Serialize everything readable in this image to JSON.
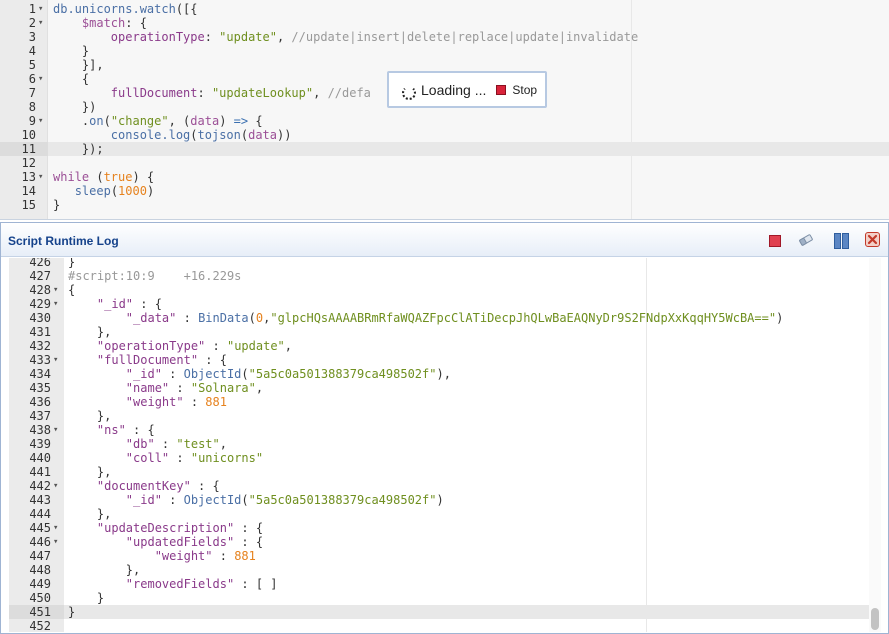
{
  "editor": {
    "lines": [
      {
        "n": "1",
        "fold": "▾",
        "segs": [
          [
            "fn",
            "db.unicorns.watch"
          ],
          [
            "op",
            "([{"
          ]
        ]
      },
      {
        "n": "2",
        "fold": "▾",
        "segs": [
          [
            "op",
            "    "
          ],
          [
            "kw",
            "$match"
          ],
          [
            "op",
            ": {"
          ]
        ]
      },
      {
        "n": "3",
        "fold": "",
        "segs": [
          [
            "op",
            "        "
          ],
          [
            "pr",
            "operationType"
          ],
          [
            "op",
            ": "
          ],
          [
            "st",
            "\"update\""
          ],
          [
            "op",
            ", "
          ],
          [
            "cm",
            "//update|insert|delete|replace|update|invalidate"
          ]
        ]
      },
      {
        "n": "4",
        "fold": "",
        "segs": [
          [
            "op",
            "    }"
          ]
        ]
      },
      {
        "n": "5",
        "fold": "",
        "segs": [
          [
            "op",
            "    }],"
          ]
        ]
      },
      {
        "n": "6",
        "fold": "▾",
        "segs": [
          [
            "op",
            "    {"
          ]
        ]
      },
      {
        "n": "7",
        "fold": "",
        "segs": [
          [
            "op",
            "        "
          ],
          [
            "pr",
            "fullDocument"
          ],
          [
            "op",
            ": "
          ],
          [
            "st",
            "\"updateLookup\""
          ],
          [
            "op",
            ", "
          ],
          [
            "cm",
            "//defa"
          ]
        ]
      },
      {
        "n": "8",
        "fold": "",
        "segs": [
          [
            "op",
            "    })"
          ]
        ]
      },
      {
        "n": "9",
        "fold": "▾",
        "segs": [
          [
            "op",
            "    ."
          ],
          [
            "fn",
            "on"
          ],
          [
            "op",
            "("
          ],
          [
            "st",
            "\"change\""
          ],
          [
            "op",
            ", ("
          ],
          [
            "kw",
            "data"
          ],
          [
            "op",
            ") "
          ],
          [
            "bl",
            "=>"
          ],
          [
            "op",
            " {"
          ]
        ]
      },
      {
        "n": "10",
        "fold": "",
        "segs": [
          [
            "op",
            "        "
          ],
          [
            "fn",
            "console.log"
          ],
          [
            "op",
            "("
          ],
          [
            "fn",
            "tojson"
          ],
          [
            "op",
            "("
          ],
          [
            "kw",
            "data"
          ],
          [
            "op",
            "))"
          ]
        ]
      },
      {
        "n": "11",
        "fold": "",
        "segs": [
          [
            "op",
            "    });"
          ]
        ],
        "active": true
      },
      {
        "n": "12",
        "fold": "",
        "segs": []
      },
      {
        "n": "13",
        "fold": "▾",
        "segs": [
          [
            "kw",
            "while"
          ],
          [
            "op",
            " ("
          ],
          [
            "nu",
            "true"
          ],
          [
            "op",
            ") {"
          ]
        ]
      },
      {
        "n": "14",
        "fold": "",
        "segs": [
          [
            "op",
            "   "
          ],
          [
            "fn",
            "sleep"
          ],
          [
            "op",
            "("
          ],
          [
            "nu",
            "1000"
          ],
          [
            "op",
            ")"
          ]
        ]
      },
      {
        "n": "15",
        "fold": "",
        "segs": [
          [
            "op",
            "}"
          ]
        ]
      }
    ]
  },
  "loading": {
    "text": "Loading ...",
    "stop_label": "Stop"
  },
  "log_panel": {
    "title": "Script Runtime Log",
    "lines": [
      {
        "n": "426",
        "fold": "",
        "segs": [
          [
            "op",
            "}"
          ]
        ]
      },
      {
        "n": "427",
        "fold": "",
        "segs": [
          [
            "cm",
            "#script:10:9    +16.229s"
          ]
        ]
      },
      {
        "n": "428",
        "fold": "▾",
        "segs": [
          [
            "op",
            "{"
          ]
        ]
      },
      {
        "n": "429",
        "fold": "▾",
        "segs": [
          [
            "op",
            "    "
          ],
          [
            "pr",
            "\"_id\""
          ],
          [
            "op",
            " : {"
          ]
        ]
      },
      {
        "n": "430",
        "fold": "",
        "segs": [
          [
            "op",
            "        "
          ],
          [
            "pr",
            "\"_data\""
          ],
          [
            "op",
            " : "
          ],
          [
            "fn",
            "BinData"
          ],
          [
            "op",
            "("
          ],
          [
            "nu",
            "0"
          ],
          [
            "op",
            ","
          ],
          [
            "st",
            "\"glpcHQsAAAABRmRfaWQAZFpcClATiDecpJhQLwBaEAQNyDr9S2FNdpXxKqqHY5WcBA==\""
          ],
          [
            "op",
            ")"
          ]
        ]
      },
      {
        "n": "431",
        "fold": "",
        "segs": [
          [
            "op",
            "    },"
          ]
        ]
      },
      {
        "n": "432",
        "fold": "",
        "segs": [
          [
            "op",
            "    "
          ],
          [
            "pr",
            "\"operationType\""
          ],
          [
            "op",
            " : "
          ],
          [
            "st",
            "\"update\""
          ],
          [
            "op",
            ","
          ]
        ]
      },
      {
        "n": "433",
        "fold": "▾",
        "segs": [
          [
            "op",
            "    "
          ],
          [
            "pr",
            "\"fullDocument\""
          ],
          [
            "op",
            " : {"
          ]
        ]
      },
      {
        "n": "434",
        "fold": "",
        "segs": [
          [
            "op",
            "        "
          ],
          [
            "pr",
            "\"_id\""
          ],
          [
            "op",
            " : "
          ],
          [
            "fn",
            "ObjectId"
          ],
          [
            "op",
            "("
          ],
          [
            "st",
            "\"5a5c0a501388379ca498502f\""
          ],
          [
            "op",
            "),"
          ]
        ]
      },
      {
        "n": "435",
        "fold": "",
        "segs": [
          [
            "op",
            "        "
          ],
          [
            "pr",
            "\"name\""
          ],
          [
            "op",
            " : "
          ],
          [
            "st",
            "\"Solnara\""
          ],
          [
            "op",
            ","
          ]
        ]
      },
      {
        "n": "436",
        "fold": "",
        "segs": [
          [
            "op",
            "        "
          ],
          [
            "pr",
            "\"weight\""
          ],
          [
            "op",
            " : "
          ],
          [
            "nu",
            "881"
          ]
        ]
      },
      {
        "n": "437",
        "fold": "",
        "segs": [
          [
            "op",
            "    },"
          ]
        ]
      },
      {
        "n": "438",
        "fold": "▾",
        "segs": [
          [
            "op",
            "    "
          ],
          [
            "pr",
            "\"ns\""
          ],
          [
            "op",
            " : {"
          ]
        ]
      },
      {
        "n": "439",
        "fold": "",
        "segs": [
          [
            "op",
            "        "
          ],
          [
            "pr",
            "\"db\""
          ],
          [
            "op",
            " : "
          ],
          [
            "st",
            "\"test\""
          ],
          [
            "op",
            ","
          ]
        ]
      },
      {
        "n": "440",
        "fold": "",
        "segs": [
          [
            "op",
            "        "
          ],
          [
            "pr",
            "\"coll\""
          ],
          [
            "op",
            " : "
          ],
          [
            "st",
            "\"unicorns\""
          ]
        ]
      },
      {
        "n": "441",
        "fold": "",
        "segs": [
          [
            "op",
            "    },"
          ]
        ]
      },
      {
        "n": "442",
        "fold": "▾",
        "segs": [
          [
            "op",
            "    "
          ],
          [
            "pr",
            "\"documentKey\""
          ],
          [
            "op",
            " : {"
          ]
        ]
      },
      {
        "n": "443",
        "fold": "",
        "segs": [
          [
            "op",
            "        "
          ],
          [
            "pr",
            "\"_id\""
          ],
          [
            "op",
            " : "
          ],
          [
            "fn",
            "ObjectId"
          ],
          [
            "op",
            "("
          ],
          [
            "st",
            "\"5a5c0a501388379ca498502f\""
          ],
          [
            "op",
            ")"
          ]
        ]
      },
      {
        "n": "444",
        "fold": "",
        "segs": [
          [
            "op",
            "    },"
          ]
        ]
      },
      {
        "n": "445",
        "fold": "▾",
        "segs": [
          [
            "op",
            "    "
          ],
          [
            "pr",
            "\"updateDescription\""
          ],
          [
            "op",
            " : {"
          ]
        ]
      },
      {
        "n": "446",
        "fold": "▾",
        "segs": [
          [
            "op",
            "        "
          ],
          [
            "pr",
            "\"updatedFields\""
          ],
          [
            "op",
            " : {"
          ]
        ]
      },
      {
        "n": "447",
        "fold": "",
        "segs": [
          [
            "op",
            "            "
          ],
          [
            "pr",
            "\"weight\""
          ],
          [
            "op",
            " : "
          ],
          [
            "nu",
            "881"
          ]
        ]
      },
      {
        "n": "448",
        "fold": "",
        "segs": [
          [
            "op",
            "        },"
          ]
        ]
      },
      {
        "n": "449",
        "fold": "",
        "segs": [
          [
            "op",
            "        "
          ],
          [
            "pr",
            "\"removedFields\""
          ],
          [
            "op",
            " : [ ]"
          ]
        ]
      },
      {
        "n": "450",
        "fold": "",
        "segs": [
          [
            "op",
            "    }"
          ]
        ]
      },
      {
        "n": "451",
        "fold": "",
        "segs": [
          [
            "op",
            "}"
          ]
        ],
        "active": true
      },
      {
        "n": "452",
        "fold": "",
        "segs": []
      }
    ]
  },
  "icons": {
    "stop": "stop-icon",
    "clear": "eraser-icon",
    "pause": "pause-icon",
    "close": "close-icon",
    "spinner": "spinner-icon"
  },
  "colors": {
    "panel_title": "#15428b",
    "string": "#6f8f1f",
    "number": "#e6821e",
    "comment": "#999999",
    "property": "#8a3a8a"
  }
}
